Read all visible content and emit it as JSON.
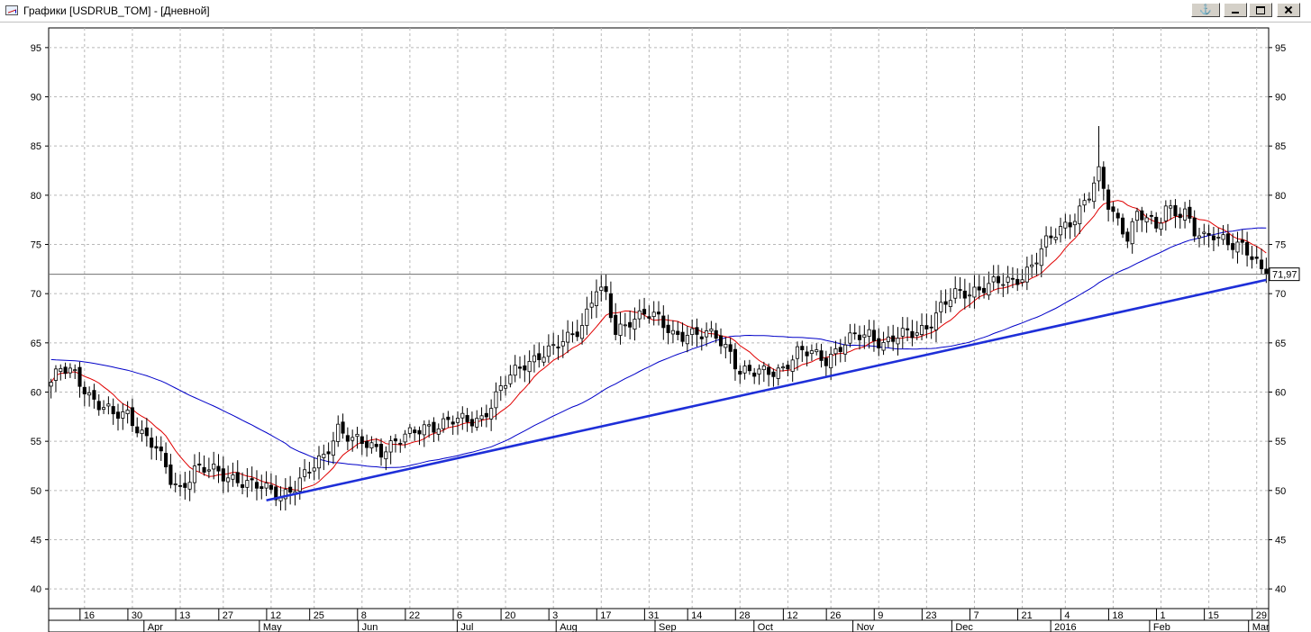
{
  "window": {
    "title": "Графики [USDRUB_TOM] - [Дневной]",
    "icons": {
      "app": "chart-window-icon",
      "anchor": "anchor-icon",
      "minimize": "minimize-icon",
      "restore": "restore-icon",
      "close": "close-icon"
    },
    "anchor_glyph": "⚓"
  },
  "chart_data": {
    "type": "candlestick",
    "instrument": "USDRUB_TOM",
    "timeframe": "Дневной",
    "ylim": [
      38,
      97
    ],
    "y_ticks": [
      40,
      45,
      50,
      55,
      60,
      65,
      70,
      75,
      80,
      85,
      90,
      95
    ],
    "grid": true,
    "last_price": 71.97,
    "last_price_label": "71,97",
    "date_ticks": [
      {
        "label": "16",
        "index": 7
      },
      {
        "label": "30",
        "index": 17
      },
      {
        "label": "13",
        "index": 27
      },
      {
        "label": "27",
        "index": 36
      },
      {
        "label": "12",
        "index": 46
      },
      {
        "label": "25",
        "index": 55
      },
      {
        "label": "8",
        "index": 65
      },
      {
        "label": "22",
        "index": 75
      },
      {
        "label": "6",
        "index": 85
      },
      {
        "label": "20",
        "index": 95
      },
      {
        "label": "3",
        "index": 105
      },
      {
        "label": "17",
        "index": 115
      },
      {
        "label": "31",
        "index": 125
      },
      {
        "label": "14",
        "index": 134
      },
      {
        "label": "28",
        "index": 144
      },
      {
        "label": "12",
        "index": 154
      },
      {
        "label": "26",
        "index": 163
      },
      {
        "label": "9",
        "index": 173
      },
      {
        "label": "23",
        "index": 183
      },
      {
        "label": "7",
        "index": 193
      },
      {
        "label": "21",
        "index": 203
      },
      {
        "label": "4",
        "index": 212
      },
      {
        "label": "18",
        "index": 222
      },
      {
        "label": "1",
        "index": 232
      },
      {
        "label": "15",
        "index": 242
      },
      {
        "label": "29",
        "index": 252
      }
    ],
    "month_ticks": [
      {
        "label": "Apr",
        "index": 12
      },
      {
        "label": "May",
        "index": 26
      },
      {
        "label": "Jun",
        "index": 38
      },
      {
        "label": "Jul",
        "index": 50
      },
      {
        "label": "Aug",
        "index": 62
      },
      {
        "label": "Sep",
        "index": 74
      },
      {
        "label": "Oct",
        "index": 86
      },
      {
        "label": "Nov",
        "index": 98
      },
      {
        "label": "Dec",
        "index": 110
      },
      {
        "label": "2016",
        "index": 122
      },
      {
        "label": "Feb",
        "index": 134
      },
      {
        "label": "Mar",
        "index": 146
      }
    ],
    "price_anchors": [
      [
        0,
        61.0
      ],
      [
        2,
        62.2
      ],
      [
        5,
        61.8
      ],
      [
        8,
        59.8
      ],
      [
        10,
        58.8
      ],
      [
        13,
        57.5
      ],
      [
        16,
        57.8
      ],
      [
        19,
        56.0
      ],
      [
        22,
        54.2
      ],
      [
        25,
        51.0
      ],
      [
        27,
        50.2
      ],
      [
        30,
        52.3
      ],
      [
        33,
        52.0
      ],
      [
        36,
        51.5
      ],
      [
        39,
        51.3
      ],
      [
        42,
        50.5
      ],
      [
        45,
        50.0
      ],
      [
        48,
        49.6
      ],
      [
        51,
        50.5
      ],
      [
        54,
        51.8
      ],
      [
        57,
        53.5
      ],
      [
        60,
        56.5
      ],
      [
        63,
        55.0
      ],
      [
        66,
        54.6
      ],
      [
        69,
        54.2
      ],
      [
        72,
        55.0
      ],
      [
        75,
        55.5
      ],
      [
        78,
        56.5
      ],
      [
        81,
        56.8
      ],
      [
        84,
        57.0
      ],
      [
        87,
        57.0
      ],
      [
        90,
        57.5
      ],
      [
        93,
        59.5
      ],
      [
        96,
        61.5
      ],
      [
        99,
        63.0
      ],
      [
        102,
        63.8
      ],
      [
        105,
        64.2
      ],
      [
        108,
        65.5
      ],
      [
        111,
        67.0
      ],
      [
        114,
        70.5
      ],
      [
        116,
        69.5
      ],
      [
        118,
        66.0
      ],
      [
        121,
        67.5
      ],
      [
        124,
        68.0
      ],
      [
        127,
        67.2
      ],
      [
        130,
        66.0
      ],
      [
        133,
        66.0
      ],
      [
        136,
        65.6
      ],
      [
        139,
        65.8
      ],
      [
        142,
        64.2
      ],
      [
        144,
        62.0
      ],
      [
        147,
        61.8
      ],
      [
        150,
        62.2
      ],
      [
        153,
        62.5
      ],
      [
        156,
        63.8
      ],
      [
        159,
        64.0
      ],
      [
        162,
        63.5
      ],
      [
        165,
        64.5
      ],
      [
        168,
        65.5
      ],
      [
        171,
        66.0
      ],
      [
        174,
        65.0
      ],
      [
        177,
        65.5
      ],
      [
        180,
        66.0
      ],
      [
        183,
        66.8
      ],
      [
        186,
        68.5
      ],
      [
        189,
        69.8
      ],
      [
        192,
        70.3
      ],
      [
        195,
        70.8
      ],
      [
        198,
        71.0
      ],
      [
        201,
        71.2
      ],
      [
        203,
        72.0
      ],
      [
        205,
        73.0
      ],
      [
        208,
        75.0
      ],
      [
        211,
        76.5
      ],
      [
        214,
        78.0
      ],
      [
        217,
        80.0
      ],
      [
        219,
        82.0
      ],
      [
        221,
        79.0
      ],
      [
        223,
        77.5
      ],
      [
        225,
        76.0
      ],
      [
        227,
        78.0
      ],
      [
        229,
        77.5
      ],
      [
        231,
        76.5
      ],
      [
        233,
        79.0
      ],
      [
        235,
        78.5
      ],
      [
        237,
        78.2
      ],
      [
        239,
        76.0
      ],
      [
        241,
        75.5
      ],
      [
        243,
        76.2
      ],
      [
        245,
        75.8
      ],
      [
        247,
        75.0
      ],
      [
        249,
        74.5
      ],
      [
        251,
        73.5
      ],
      [
        253,
        72.5
      ],
      [
        254,
        71.97
      ]
    ],
    "series": [
      {
        "name": "candles",
        "color": "#000000"
      },
      {
        "name": "ma-short",
        "color": "#e00000",
        "period": 10
      },
      {
        "name": "ma-long",
        "color": "#0000c8",
        "period": 50
      }
    ],
    "ma_long_start": 63.3,
    "trendline": {
      "color": "#1e2fd8",
      "from": [
        45,
        49.0
      ],
      "to": [
        254,
        71.4
      ]
    }
  }
}
